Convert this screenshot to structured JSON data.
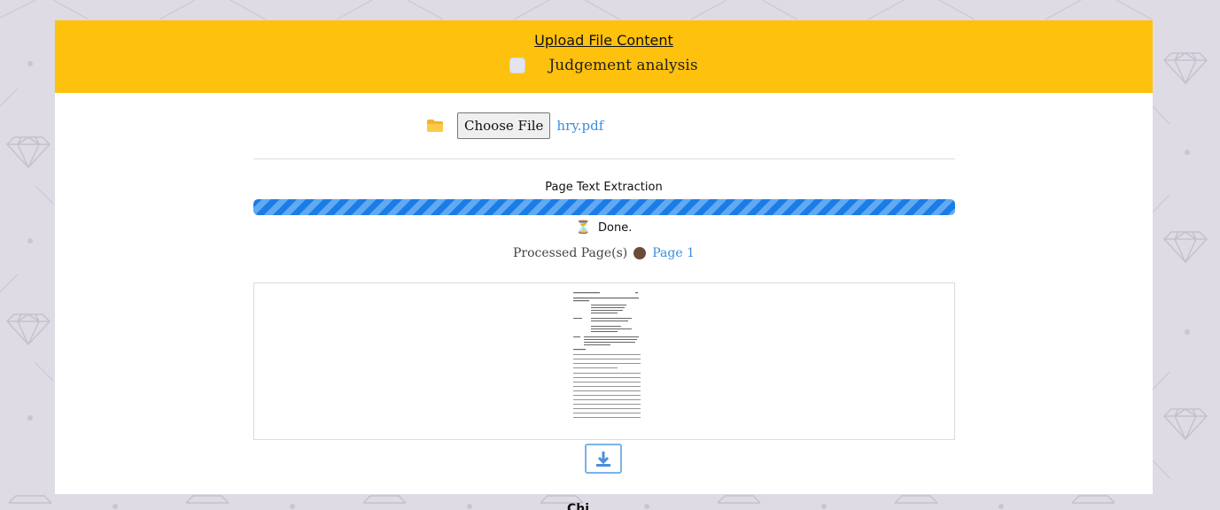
{
  "header": {
    "title": "Upload File Content",
    "checkbox_label": "Judgement analysis",
    "checkbox_checked": false
  },
  "file_input": {
    "button_label": "Choose File",
    "file_name": "hry.pdf",
    "icon": "folder-icon"
  },
  "extraction": {
    "title": "Page Text Extraction",
    "progress": 1.0,
    "status_icon": "hourglass-icon",
    "status_text": "Done.",
    "processed_label": "Processed Page(s)",
    "pages": [
      "Page 1"
    ]
  },
  "preview": {
    "icon": "document-thumbnail"
  },
  "download": {
    "icon": "download-icon"
  },
  "footer": {
    "partial_text": "Chi"
  },
  "colors": {
    "header_bg": "#fec10d",
    "accent": "#3a8fe0",
    "progress": "#1a7de6",
    "background": "#dedbe4"
  }
}
